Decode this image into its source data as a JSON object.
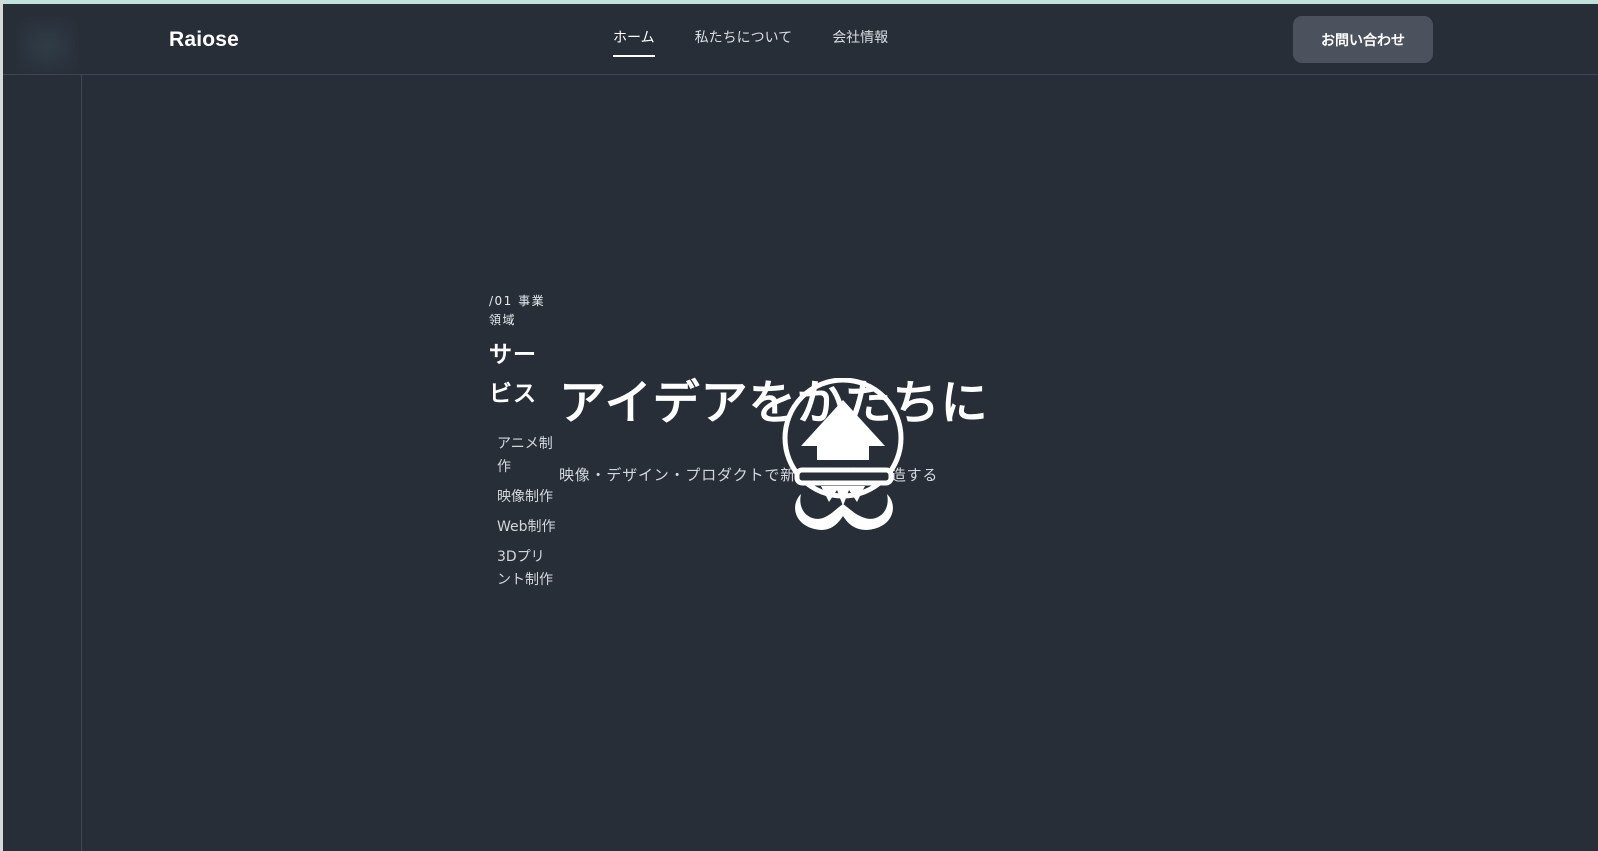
{
  "header": {
    "brand": "Raiose",
    "nav": [
      {
        "label": "ホーム",
        "active": true
      },
      {
        "label": "私たちについて",
        "active": false
      },
      {
        "label": "会社情報",
        "active": false
      }
    ],
    "contact_label": "お問い合わせ"
  },
  "services": {
    "eyebrow": "/01 事業領域",
    "title": "サービス",
    "items": [
      "アニメ制作",
      "映像制作",
      "Web制作",
      "3Dプリント制作"
    ]
  },
  "hero": {
    "title": "アイデアをかたちに",
    "subtitle": "映像・デザイン・プロダクトで新しい価値を創造する",
    "icon": "lightbulb-house-icon"
  },
  "colors": {
    "background": "#282e37",
    "accent_strip": "#c3e1dc",
    "button": "#4b525d",
    "text": "#ffffff"
  }
}
